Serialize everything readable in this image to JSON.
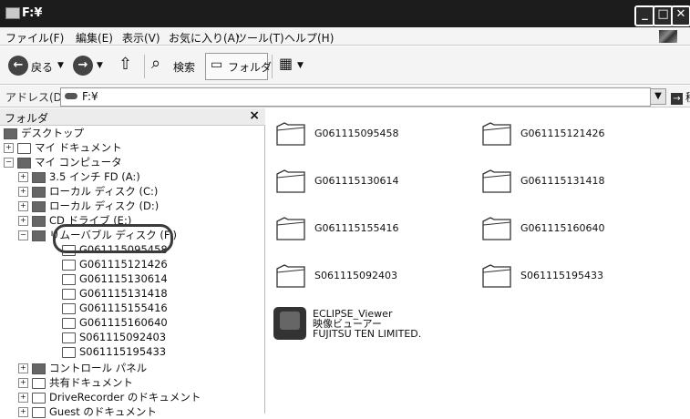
{
  "window": {
    "title": "F:¥"
  },
  "menu": [
    "ファイル(F)",
    "編集(E)",
    "表示(V)",
    "お気に入り(A)",
    "ツール(T)",
    "ヘルプ(H)"
  ],
  "toolbar": {
    "back": "戻る",
    "search": "検索",
    "folders": "フォルダ"
  },
  "address": {
    "label": "アドレス(D)",
    "value": "F:¥",
    "go": "移動"
  },
  "folder_pane": {
    "title": "フォルダ",
    "close": "×",
    "tree": [
      {
        "label": "デスクトップ"
      },
      {
        "label": "マイ ドキュメント"
      },
      {
        "label": "マイ コンピュータ"
      },
      {
        "label": "3.5 インチ FD (A:)"
      },
      {
        "label": "ローカル ディスク (C:)"
      },
      {
        "label": "ローカル ディスク (D:)"
      },
      {
        "label": "CD ドライブ (E:)"
      },
      {
        "label": "リムーバブル ディスク (F:)"
      },
      {
        "label": "G061115095458"
      },
      {
        "label": "G061115121426"
      },
      {
        "label": "G061115130614"
      },
      {
        "label": "G061115131418"
      },
      {
        "label": "G061115155416"
      },
      {
        "label": "G061115160640"
      },
      {
        "label": "S061115092403"
      },
      {
        "label": "S061115195433"
      },
      {
        "label": "コントロール パネル"
      },
      {
        "label": "共有ドキュメント"
      },
      {
        "label": "DriveRecorder のドキュメント"
      },
      {
        "label": "Guest のドキュメント"
      }
    ]
  },
  "content": {
    "folders": [
      "G061115095458",
      "G061115121426",
      "G061115130614",
      "G061115131418",
      "G061115155416",
      "G061115160640",
      "S061115092403",
      "S061115195433"
    ],
    "app": {
      "name": "ECLIPSE_Viewer",
      "desc": "映像ビューアー",
      "company": "FUJITSU TEN LIMITED."
    }
  }
}
